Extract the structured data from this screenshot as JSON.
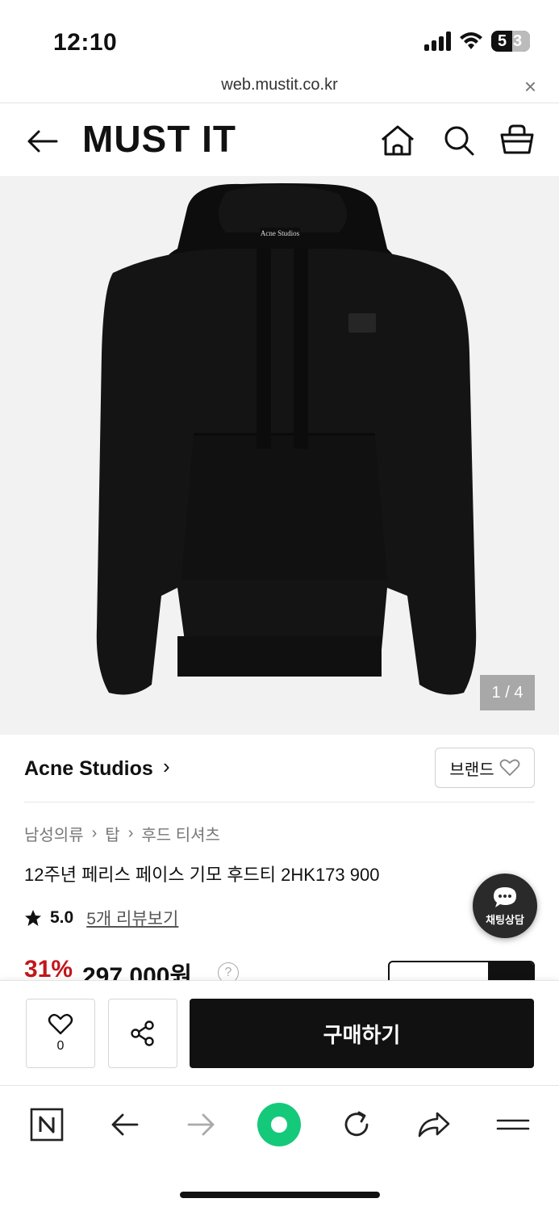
{
  "status_bar": {
    "time": "12:10",
    "battery_left": "5",
    "battery_right": "3"
  },
  "browser": {
    "url": "web.mustit.co.kr",
    "close_label": "×"
  },
  "header": {
    "logo": "MUST IT"
  },
  "gallery": {
    "counter": "1 / 4"
  },
  "brand": {
    "name": "Acne Studios",
    "chevron": "›",
    "button_label": "브랜드"
  },
  "breadcrumb": [
    "남성의류",
    "탑",
    "후드 티셔츠"
  ],
  "product": {
    "title": "12주년 페리스 페이스 기모 후드티 2HK173 900",
    "rating": "5.0",
    "reviews_link": "5개 리뷰보기",
    "discount": "31%",
    "price": "297,000원",
    "help": "?"
  },
  "chat": {
    "label": "채팅상담"
  },
  "buy_bar": {
    "wish_count": "0",
    "buy_label": "구매하기"
  },
  "colors": {
    "accent_red": "#c2161b",
    "brand_black": "#111111",
    "fab_green": "#15c97a"
  }
}
